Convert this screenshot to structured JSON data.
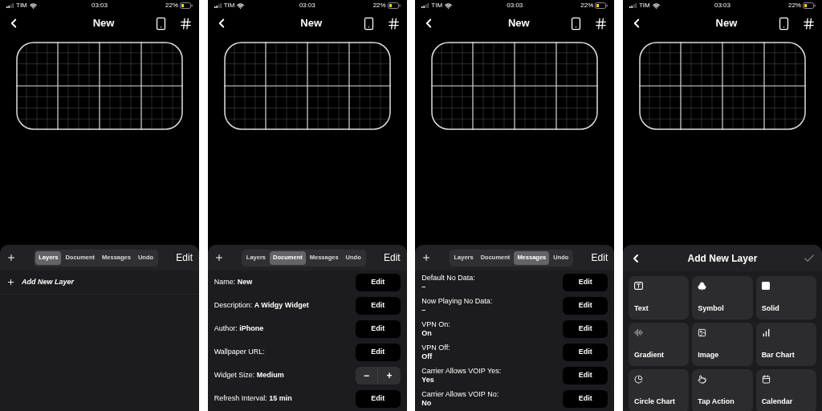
{
  "screens": [
    {
      "status_bar": {
        "carrier": "TIM",
        "time": "03:03",
        "battery": "22%"
      },
      "nav": {
        "title": "New"
      },
      "panel": {
        "kind": "layers",
        "tabs": [
          {
            "label": "Layers",
            "selected": true
          },
          {
            "label": "Document",
            "selected": false
          },
          {
            "label": "Messages",
            "selected": false
          },
          {
            "label": "Undo",
            "selected": false
          }
        ],
        "edit": "Edit",
        "add_label": "Add New Layer"
      }
    },
    {
      "status_bar": {
        "carrier": "TIM",
        "time": "03:03",
        "battery": "22%"
      },
      "nav": {
        "title": "New"
      },
      "panel": {
        "kind": "document",
        "tabs": [
          {
            "label": "Layers",
            "selected": false
          },
          {
            "label": "Document",
            "selected": true
          },
          {
            "label": "Messages",
            "selected": false
          },
          {
            "label": "Undo",
            "selected": false
          }
        ],
        "edit": "Edit",
        "rows": [
          {
            "kind": "button",
            "text": "Name: **New**",
            "button": "Edit"
          },
          {
            "kind": "button",
            "text": "Description: **A Widgy Widget**",
            "button": "Edit"
          },
          {
            "kind": "button",
            "text": "Author: **iPhone**",
            "button": "Edit"
          },
          {
            "kind": "button",
            "text": "Wallpaper URL:",
            "button": "Edit"
          },
          {
            "kind": "stepper",
            "text": "Widget Size: **Medium**",
            "minus": "−",
            "plus": "+"
          },
          {
            "kind": "button",
            "text": "Refresh Interval: **15 min**",
            "button": "Edit"
          }
        ]
      }
    },
    {
      "status_bar": {
        "carrier": "TIM",
        "time": "03:03",
        "battery": "22%"
      },
      "nav": {
        "title": "New"
      },
      "panel": {
        "kind": "messages",
        "tabs": [
          {
            "label": "Layers",
            "selected": false
          },
          {
            "label": "Document",
            "selected": false
          },
          {
            "label": "Messages",
            "selected": true
          },
          {
            "label": "Undo",
            "selected": false
          }
        ],
        "edit": "Edit",
        "rows": [
          {
            "label": "Default No Data:",
            "value": "–",
            "button": "Edit"
          },
          {
            "label": "Now Playing No Data:",
            "value": "–",
            "button": "Edit"
          },
          {
            "label": "VPN On:",
            "value": "On",
            "button": "Edit"
          },
          {
            "label": "VPN Off:",
            "value": "Off",
            "button": "Edit"
          },
          {
            "label": "Carrier Allows VOIP Yes:",
            "value": "Yes",
            "button": "Edit"
          },
          {
            "label": "Carrier Allows VOIP No:",
            "value": "No",
            "button": "Edit"
          }
        ]
      }
    },
    {
      "status_bar": {
        "carrier": "TIM",
        "time": "03:03",
        "battery": "22%"
      },
      "nav": {
        "title": "New"
      },
      "panel": {
        "kind": "add_layer",
        "title": "Add New Layer",
        "tiles": [
          {
            "label": "Text"
          },
          {
            "label": "Symbol"
          },
          {
            "label": "Solid"
          },
          {
            "label": "Gradient"
          },
          {
            "label": "Image"
          },
          {
            "label": "Bar Chart"
          },
          {
            "label": "Circle Chart"
          },
          {
            "label": "Tap Action"
          },
          {
            "label": "Calendar"
          }
        ]
      }
    }
  ]
}
